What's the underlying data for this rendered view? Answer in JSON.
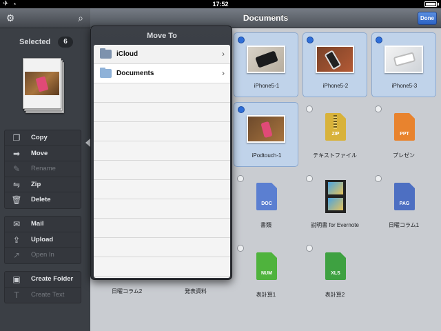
{
  "status_bar": {
    "time": "17:52"
  },
  "sidebar": {
    "selected_label": "Selected",
    "selected_count": "6",
    "actions_group1": [
      {
        "label": "Copy",
        "icon": "copy-icon",
        "glyph": "❐",
        "enabled": true
      },
      {
        "label": "Move",
        "icon": "move-icon",
        "glyph": "➡",
        "enabled": true
      },
      {
        "label": "Rename",
        "icon": "rename-icon",
        "glyph": "✎",
        "enabled": false
      },
      {
        "label": "Zip",
        "icon": "zip-icon",
        "glyph": "⇋",
        "enabled": true
      },
      {
        "label": "Delete",
        "icon": "trash-icon",
        "glyph": "🗑",
        "enabled": true
      }
    ],
    "actions_group2": [
      {
        "label": "Mail",
        "icon": "mail-icon",
        "glyph": "✉",
        "enabled": true
      },
      {
        "label": "Upload",
        "icon": "upload-icon",
        "glyph": "⇪",
        "enabled": true
      },
      {
        "label": "Open In",
        "icon": "open-in-icon",
        "glyph": "↗",
        "enabled": false
      }
    ],
    "actions_group3": [
      {
        "label": "Create Folder",
        "icon": "new-folder-icon",
        "glyph": "▣",
        "enabled": true
      },
      {
        "label": "Create Text",
        "icon": "new-text-icon",
        "glyph": "T",
        "enabled": false
      }
    ]
  },
  "navbar": {
    "title": "Documents",
    "done_label": "Done"
  },
  "popover": {
    "title": "Move To",
    "items": [
      {
        "label": "iCloud"
      },
      {
        "label": "Documents"
      }
    ]
  },
  "files": [
    {
      "name": "iPhone5-1",
      "kind": "photo",
      "selected": true
    },
    {
      "name": "iPhone5-2",
      "kind": "photo",
      "selected": true
    },
    {
      "name": "iPhone5-3",
      "kind": "photo",
      "selected": true
    },
    {
      "name": "iPodtouch-1",
      "kind": "photo",
      "selected": true
    },
    {
      "name": "テキストファイル",
      "kind": "zip",
      "tag": "ZIP",
      "selected": false
    },
    {
      "name": "プレゼン",
      "kind": "ppt",
      "tag": "PPT",
      "selected": false
    },
    {
      "name": "書類",
      "kind": "doc",
      "tag": "DOC",
      "selected": false
    },
    {
      "name": "説明書 for Evernote",
      "kind": "video",
      "selected": false
    },
    {
      "name": "日曜コラム1",
      "kind": "pages",
      "tag": "PAG",
      "selected": false
    },
    {
      "name": "表計算1",
      "kind": "numbers",
      "tag": "NUM",
      "selected": false
    },
    {
      "name": "表計算2",
      "kind": "excel",
      "tag": "XLS",
      "selected": false
    }
  ],
  "hidden_under_popover_labels": [
    "日曜コラム2",
    "発表資料"
  ],
  "colors": {
    "selection_fill": "#c0d3ea",
    "accent_blue": "#2f6ed8",
    "sidebar_bg": "#3b3f45"
  }
}
